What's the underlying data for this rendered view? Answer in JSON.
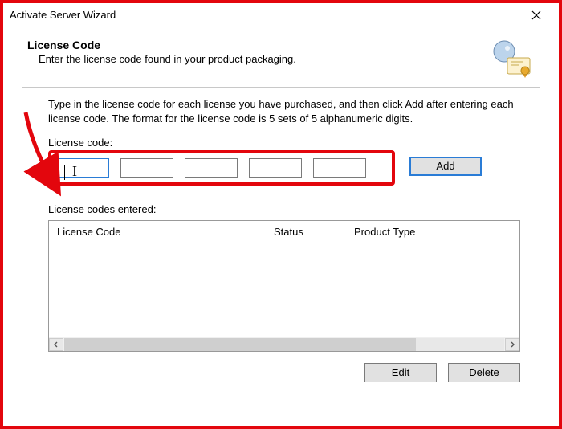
{
  "window": {
    "title": "Activate Server Wizard"
  },
  "header": {
    "title": "License Code",
    "subtitle": "Enter the license code found in your product packaging."
  },
  "instruction": "Type in the license code for each license you have purchased, and then click Add after entering each license code. The format for the license code is 5 sets of 5 alphanumeric digits.",
  "license_input": {
    "label": "License code:",
    "fields": [
      "",
      "",
      "",
      "",
      ""
    ]
  },
  "buttons": {
    "add": "Add",
    "edit": "Edit",
    "delete": "Delete"
  },
  "entered": {
    "label": "License codes entered:",
    "columns": {
      "license": "License Code",
      "status": "Status",
      "type": "Product Type"
    },
    "rows": []
  }
}
